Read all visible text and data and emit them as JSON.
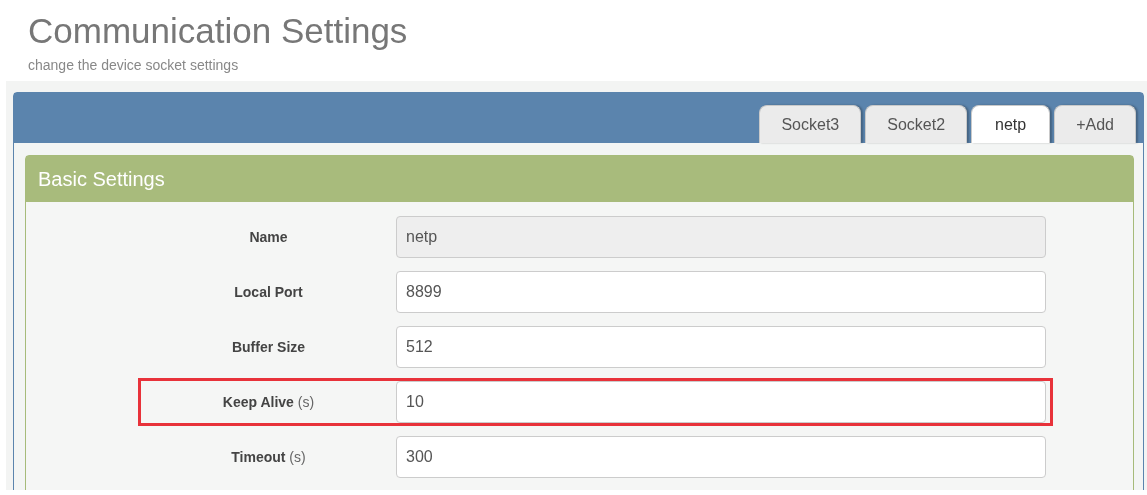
{
  "header": {
    "title": "Communication Settings",
    "subtitle": "change the device socket settings"
  },
  "tabs": [
    {
      "label": "Socket3",
      "selected": false
    },
    {
      "label": "Socket2",
      "selected": false
    },
    {
      "label": "netp",
      "selected": true
    },
    {
      "label": "+Add",
      "selected": false
    }
  ],
  "panel": {
    "title": "Basic Settings"
  },
  "fields": [
    {
      "label": "Name",
      "value": "netp",
      "disabled": true,
      "highlighted": false
    },
    {
      "label": "Local Port",
      "value": "8899",
      "disabled": false,
      "highlighted": false
    },
    {
      "label": "Buffer Size",
      "value": "512",
      "disabled": false,
      "highlighted": false
    },
    {
      "label": "Keep Alive",
      "unit": "(s)",
      "value": "10",
      "disabled": false,
      "highlighted": true
    },
    {
      "label": "Timeout",
      "unit": "(s)",
      "value": "300",
      "disabled": false,
      "highlighted": false
    }
  ]
}
